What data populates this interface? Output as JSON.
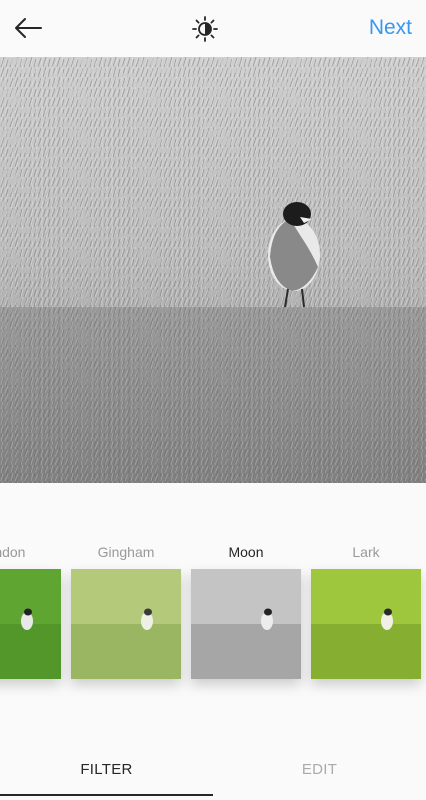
{
  "header": {
    "back_icon": "arrow-left-icon",
    "lux_icon": "brightness-icon",
    "next_label": "Next",
    "accent_color": "#3897f0"
  },
  "filters": {
    "items": [
      {
        "name": "endon",
        "style": "color"
      },
      {
        "name": "Gingham",
        "style": "faded"
      },
      {
        "name": "Moon",
        "style": "mono",
        "selected": true
      },
      {
        "name": "Lark",
        "style": "bright"
      }
    ]
  },
  "tabs": {
    "filter_label": "FILTER",
    "edit_label": "EDIT",
    "active": "FILTER"
  }
}
